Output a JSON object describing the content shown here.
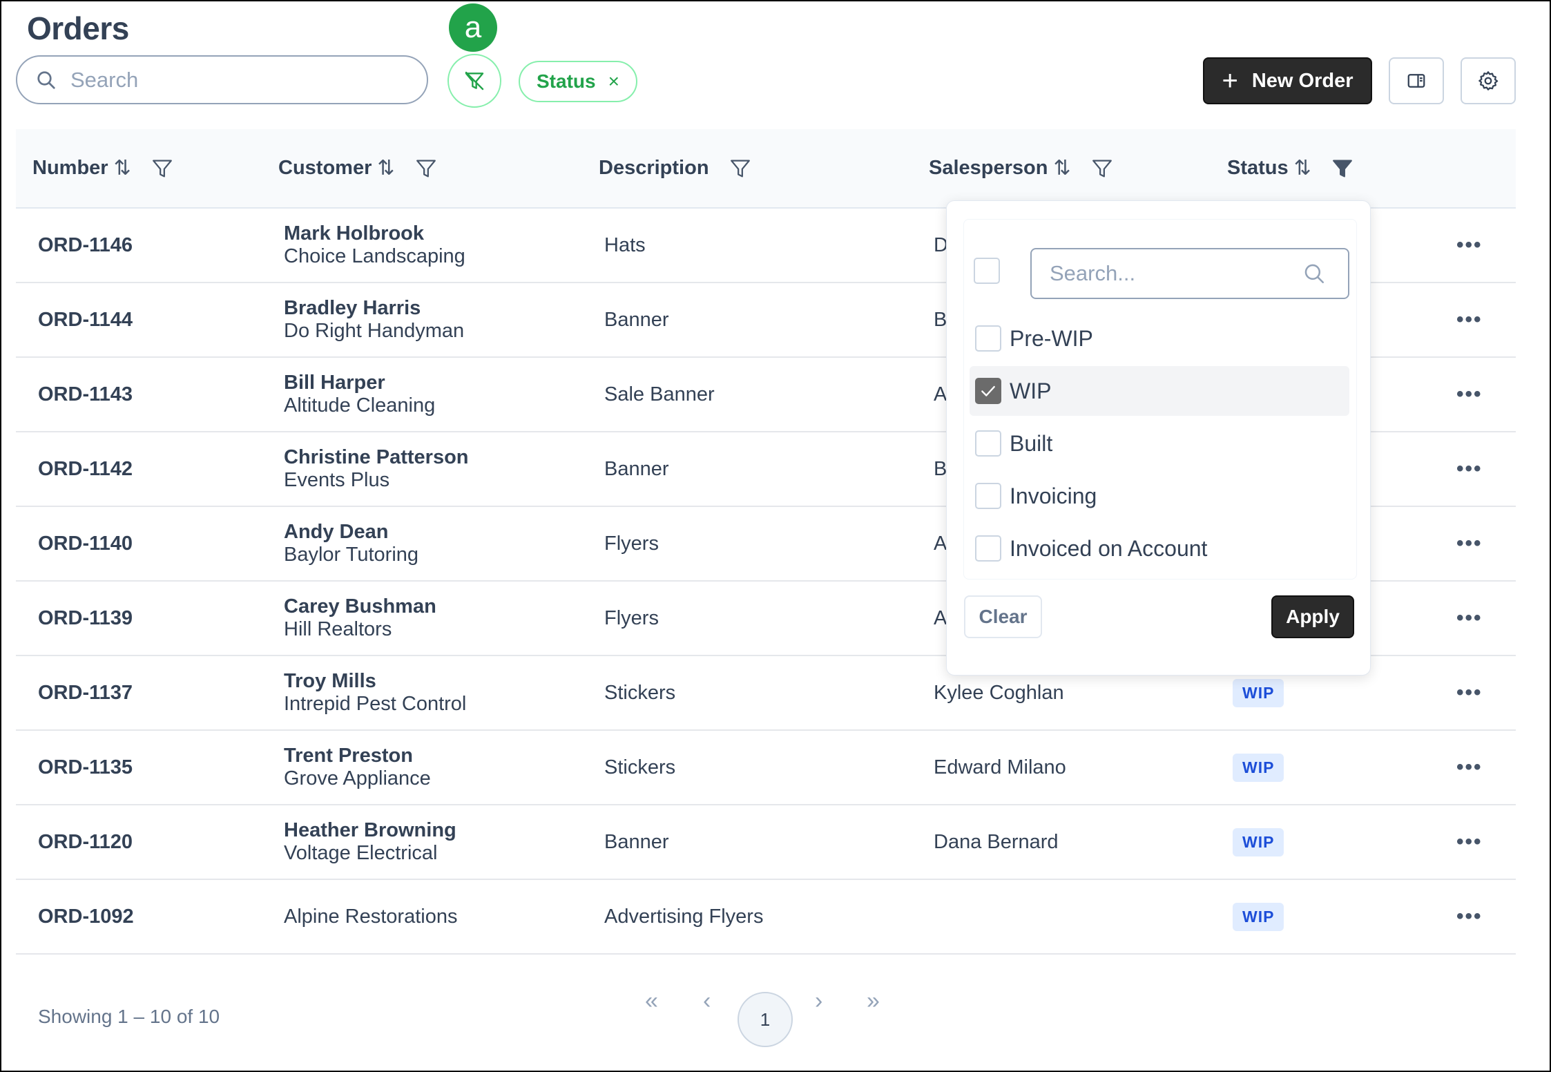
{
  "page": {
    "title": "Orders"
  },
  "toolbar": {
    "search_placeholder": "Search",
    "badge_label": "a",
    "status_chip_label": "Status",
    "status_chip_close": "×",
    "new_order_label": "New Order",
    "new_order_plus": "+"
  },
  "table": {
    "columns": [
      {
        "label": "Number",
        "sortable": true,
        "filter": true
      },
      {
        "label": "Customer",
        "sortable": true,
        "filter": true
      },
      {
        "label": "Description",
        "sortable": false,
        "filter": true
      },
      {
        "label": "Salesperson",
        "sortable": true,
        "filter": true
      },
      {
        "label": "Status",
        "sortable": true,
        "filter": true,
        "filter_active": true
      }
    ],
    "sort_glyph": "⇅",
    "more_glyph": "•••",
    "rows": [
      {
        "number": "ORD-1146",
        "contact": "Mark Holbrook",
        "company": "Choice Landscaping",
        "description": "Hats",
        "salesperson": "D",
        "status": ""
      },
      {
        "number": "ORD-1144",
        "contact": "Bradley Harris",
        "company": "Do Right Handyman",
        "description": "Banner",
        "salesperson": "B",
        "status": ""
      },
      {
        "number": "ORD-1143",
        "contact": "Bill Harper",
        "company": "Altitude Cleaning",
        "description": "Sale Banner",
        "salesperson": "A",
        "status": ""
      },
      {
        "number": "ORD-1142",
        "contact": "Christine Patterson",
        "company": "Events Plus",
        "description": "Banner",
        "salesperson": "B",
        "status": ""
      },
      {
        "number": "ORD-1140",
        "contact": "Andy Dean",
        "company": "Baylor Tutoring",
        "description": "Flyers",
        "salesperson": "A",
        "status": ""
      },
      {
        "number": "ORD-1139",
        "contact": "Carey Bushman",
        "company": "Hill Realtors",
        "description": "Flyers",
        "salesperson": "A",
        "status": ""
      },
      {
        "number": "ORD-1137",
        "contact": "Troy Mills",
        "company": "Intrepid Pest Control",
        "description": "Stickers",
        "salesperson": "Kylee Coghlan",
        "status": "WIP"
      },
      {
        "number": "ORD-1135",
        "contact": "Trent Preston",
        "company": "Grove Appliance",
        "description": "Stickers",
        "salesperson": "Edward Milano",
        "status": "WIP"
      },
      {
        "number": "ORD-1120",
        "contact": "Heather Browning",
        "company": "Voltage Electrical",
        "description": "Banner",
        "salesperson": "Dana Bernard",
        "status": "WIP"
      },
      {
        "number": "ORD-1092",
        "contact": "",
        "company": "Alpine Restorations",
        "description": "Advertising Flyers",
        "salesperson": "",
        "status": "WIP"
      }
    ]
  },
  "status_filter": {
    "search_placeholder": "Search...",
    "options": [
      {
        "label": "Pre-WIP",
        "checked": false
      },
      {
        "label": "WIP",
        "checked": true
      },
      {
        "label": "Built",
        "checked": false
      },
      {
        "label": "Invoicing",
        "checked": false
      },
      {
        "label": "Invoiced on Account",
        "checked": false
      }
    ],
    "clear_label": "Clear",
    "apply_label": "Apply"
  },
  "pagination": {
    "summary": "Showing 1 – 10 of 10",
    "first": "«",
    "prev": "‹",
    "current": "1",
    "next": "›",
    "last": "»"
  },
  "colors": {
    "accent_green": "#22a34a",
    "primary_dark": "#2b2b2b",
    "wip_bg": "#e0ecff",
    "wip_text": "#1d4ed8"
  }
}
